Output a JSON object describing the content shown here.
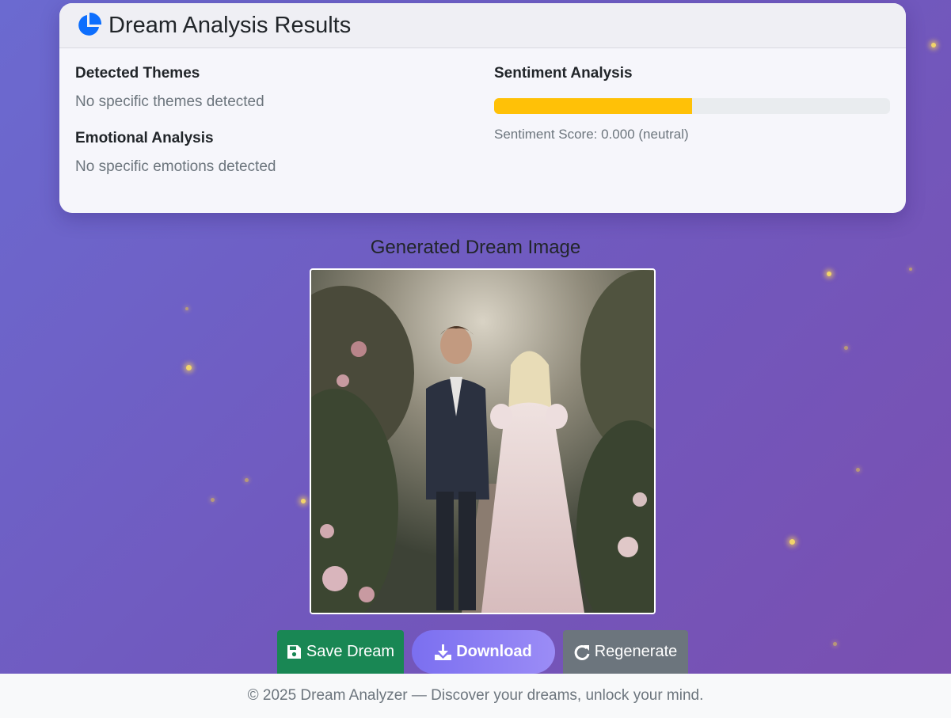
{
  "results": {
    "title": "Dream Analysis Results",
    "themes_heading": "Detected Themes",
    "themes_text": "No specific themes detected",
    "emotions_heading": "Emotional Analysis",
    "emotions_text": "No specific emotions detected",
    "sentiment_heading": "Sentiment Analysis",
    "sentiment_fill_percent": 50,
    "sentiment_score_text": "Sentiment Score: 0.000 (neutral)"
  },
  "image_section": {
    "title": "Generated Dream Image"
  },
  "actions": {
    "save_label": "Save Dream",
    "download_label": "Download",
    "regenerate_label": "Regenerate"
  },
  "footer": {
    "text": "© 2025 Dream Analyzer — Discover your dreams, unlock your mind."
  },
  "icons": {
    "header": "pie-chart-icon",
    "save": "floppy-disk-icon",
    "download": "download-icon",
    "regenerate": "redo-arrow-icon"
  },
  "colors": {
    "sentiment_bar": "#ffc107",
    "save_button": "#198754",
    "regenerate_button": "#6c757d",
    "header_icon": "#0d6efd"
  }
}
